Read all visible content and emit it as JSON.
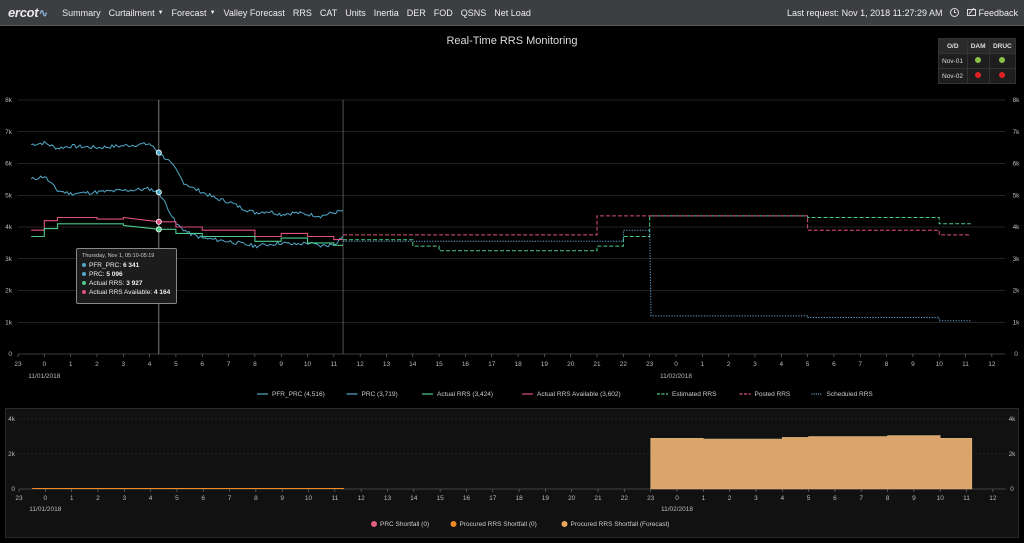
{
  "nav": {
    "logo": "ercot",
    "items": [
      {
        "label": "Summary"
      },
      {
        "label": "Curtailment",
        "dropdown": true
      },
      {
        "label": "Forecast",
        "dropdown": true
      },
      {
        "label": "Valley Forecast"
      },
      {
        "label": "RRS"
      },
      {
        "label": "CAT"
      },
      {
        "label": "Units"
      },
      {
        "label": "Inertia"
      },
      {
        "label": "DER"
      },
      {
        "label": "FOD"
      },
      {
        "label": "QSNS"
      },
      {
        "label": "Net Load"
      }
    ],
    "last_request": "Last request: Nov 1, 2018 11:27:29 AM",
    "feedback": "Feedback"
  },
  "od_table": {
    "headers": [
      "O/D",
      "DAM",
      "DRUC"
    ],
    "rows": [
      {
        "label": "Nov-01",
        "dam": "#8bc34a",
        "druc": "#8bc34a"
      },
      {
        "label": "Nov-02",
        "dam": "#e02020",
        "druc": "#e02020"
      }
    ]
  },
  "tooltip": {
    "header": "Thursday, Nov 1, 05:10-05:19",
    "rows": [
      {
        "label": "PFR_PRC: ",
        "value": "6 341",
        "color": "#4fa8c8"
      },
      {
        "label": "PRC: ",
        "value": "5 096",
        "color": "#4fa8c8"
      },
      {
        "label": "Actual RRS: ",
        "value": "3 927",
        "color": "#4ecb8a"
      },
      {
        "label": "Actual RRS Available: ",
        "value": "4 164",
        "color": "#e0507a"
      }
    ]
  },
  "chart_data": [
    {
      "type": "line",
      "title": "Real-Time RRS Monitoring",
      "x_ticks": [
        "23",
        "0",
        "1",
        "2",
        "3",
        "4",
        "5",
        "6",
        "7",
        "8",
        "9",
        "10",
        "11",
        "12",
        "13",
        "14",
        "15",
        "16",
        "17",
        "18",
        "19",
        "20",
        "21",
        "22",
        "23",
        "0",
        "1",
        "2",
        "3",
        "4",
        "5",
        "6",
        "7",
        "8",
        "9",
        "10",
        "11",
        "12"
      ],
      "date_labels": [
        {
          "tick": 1,
          "label": "11/01/2018"
        },
        {
          "tick": 25,
          "label": "11/02/2018"
        }
      ],
      "y_ticks": [
        "0",
        "1k",
        "2k",
        "3k",
        "4k",
        "5k",
        "6k",
        "7k",
        "8k"
      ],
      "ylim": [
        0,
        8000
      ],
      "xlim": [
        -1,
        36.5
      ],
      "crosshair_x": 4.35,
      "now_x": 11.35,
      "legend": [
        {
          "name": "PFR_PRC (4,516)",
          "color": "#4fa8c8",
          "dash": "solid"
        },
        {
          "name": "PRC (3,719)",
          "color": "#4fa8c8",
          "dash": "solid"
        },
        {
          "name": "Actual RRS (3,424)",
          "color": "#4ecb8a",
          "dash": "solid"
        },
        {
          "name": "Actual RRS Available (3,602)",
          "color": "#e0507a",
          "dash": "solid"
        },
        {
          "name": "Estimated RRS",
          "color": "#4ecb8a",
          "dash": "dash"
        },
        {
          "name": "Posted RRS",
          "color": "#e0507a",
          "dash": "dash"
        },
        {
          "name": "Scheduled RRS",
          "color": "#6aa8d8",
          "dash": "dot"
        }
      ],
      "series": {
        "pfr_prc": {
          "color": "#4fa8c8",
          "points": [
            [
              -0.5,
              6600
            ],
            [
              0,
              6650
            ],
            [
              0.5,
              6480
            ],
            [
              1,
              6550
            ],
            [
              2,
              6500
            ],
            [
              3,
              6560
            ],
            [
              4,
              6620
            ],
            [
              4.35,
              6341
            ],
            [
              4.7,
              6100
            ],
            [
              5,
              5800
            ],
            [
              5.3,
              5400
            ],
            [
              5.7,
              5200
            ],
            [
              6,
              5100
            ],
            [
              6.5,
              4900
            ],
            [
              7,
              4800
            ],
            [
              7.5,
              4600
            ],
            [
              8,
              4450
            ],
            [
              8.5,
              4500
            ],
            [
              9,
              4400
            ],
            [
              9.5,
              4450
            ],
            [
              10,
              4400
            ],
            [
              10.5,
              4350
            ],
            [
              11,
              4450
            ],
            [
              11.35,
              4516
            ]
          ]
        },
        "prc": {
          "color": "#4fa8c8",
          "points": [
            [
              -0.5,
              5500
            ],
            [
              0,
              5600
            ],
            [
              0.5,
              5150
            ],
            [
              1,
              5050
            ],
            [
              2,
              5100
            ],
            [
              3,
              5150
            ],
            [
              4,
              5200
            ],
            [
              4.35,
              5096
            ],
            [
              4.7,
              4600
            ],
            [
              5,
              4100
            ],
            [
              5.5,
              3800
            ],
            [
              6,
              3650
            ],
            [
              7,
              3550
            ],
            [
              8,
              3400
            ],
            [
              8.5,
              3450
            ],
            [
              9,
              3500
            ],
            [
              9.5,
              3450
            ],
            [
              10,
              3500
            ],
            [
              10.5,
              3400
            ],
            [
              11,
              3450
            ],
            [
              11.35,
              3719
            ]
          ]
        },
        "actual_rrs": {
          "color": "#4ecb8a",
          "points": [
            [
              -0.5,
              3700
            ],
            [
              0,
              3700
            ],
            [
              0,
              3950
            ],
            [
              0.5,
              3950
            ],
            [
              0.5,
              4100
            ],
            [
              3,
              4100
            ],
            [
              3,
              4050
            ],
            [
              4.35,
              3927
            ],
            [
              5,
              3927
            ],
            [
              5,
              3800
            ],
            [
              6,
              3800
            ],
            [
              6,
              3700
            ],
            [
              8,
              3700
            ],
            [
              8,
              3550
            ],
            [
              9,
              3550
            ],
            [
              9,
              3650
            ],
            [
              10,
              3650
            ],
            [
              10,
              3500
            ],
            [
              11,
              3500
            ],
            [
              11,
              3424
            ],
            [
              11.35,
              3424
            ]
          ]
        },
        "actual_rrs_available": {
          "color": "#e0507a",
          "points": [
            [
              -0.5,
              3900
            ],
            [
              0,
              3900
            ],
            [
              0,
              4200
            ],
            [
              0.5,
              4200
            ],
            [
              0.5,
              4300
            ],
            [
              2,
              4300
            ],
            [
              2,
              4250
            ],
            [
              3,
              4250
            ],
            [
              3,
              4300
            ],
            [
              4.35,
              4164
            ],
            [
              5,
              4164
            ],
            [
              5,
              4000
            ],
            [
              6,
              4000
            ],
            [
              6,
              3900
            ],
            [
              8,
              3900
            ],
            [
              8,
              3700
            ],
            [
              9,
              3700
            ],
            [
              9,
              3800
            ],
            [
              10,
              3800
            ],
            [
              10,
              3700
            ],
            [
              11,
              3700
            ],
            [
              11,
              3602
            ],
            [
              11.35,
              3602
            ]
          ]
        },
        "estimated_rrs": {
          "color": "#4ecb8a",
          "dash": "4,2",
          "points": [
            [
              11.35,
              3600
            ],
            [
              14,
              3600
            ],
            [
              14,
              3400
            ],
            [
              15,
              3400
            ],
            [
              15,
              3250
            ],
            [
              21,
              3250
            ],
            [
              21,
              3400
            ],
            [
              22,
              3400
            ],
            [
              22,
              3700
            ],
            [
              23,
              3700
            ],
            [
              23,
              4350
            ],
            [
              29,
              4350
            ],
            [
              29,
              4300
            ],
            [
              34,
              4300
            ],
            [
              34,
              4100
            ],
            [
              35.2,
              4100
            ]
          ]
        },
        "posted_rrs": {
          "color": "#e0507a",
          "dash": "4,2",
          "points": [
            [
              11.35,
              3750
            ],
            [
              21,
              3750
            ],
            [
              21,
              4350
            ],
            [
              29,
              4350
            ],
            [
              29,
              3900
            ],
            [
              34,
              3900
            ],
            [
              34,
              3750
            ],
            [
              35.2,
              3750
            ]
          ]
        },
        "scheduled_rrs": {
          "color": "#6aa8d8",
          "dash": "1.2,1.5",
          "points": [
            [
              11.35,
              3550
            ],
            [
              22,
              3550
            ],
            [
              22,
              3900
            ],
            [
              23,
              3900
            ],
            [
              23.05,
              1200
            ],
            [
              29,
              1200
            ],
            [
              29,
              1150
            ],
            [
              34,
              1150
            ],
            [
              34,
              1050
            ],
            [
              35.2,
              1050
            ]
          ]
        }
      }
    },
    {
      "type": "area",
      "x_ticks": [
        "23",
        "0",
        "1",
        "2",
        "3",
        "4",
        "5",
        "6",
        "7",
        "8",
        "9",
        "10",
        "11",
        "12",
        "13",
        "14",
        "15",
        "16",
        "17",
        "18",
        "19",
        "20",
        "21",
        "22",
        "23",
        "0",
        "1",
        "2",
        "3",
        "4",
        "5",
        "6",
        "7",
        "8",
        "9",
        "10",
        "11",
        "12"
      ],
      "date_labels": [
        {
          "tick": 1,
          "label": "11/01/2018"
        },
        {
          "tick": 25,
          "label": "11/02/2018"
        }
      ],
      "y_ticks": [
        "0",
        "2k",
        "4k"
      ],
      "ylim": [
        0,
        4000
      ],
      "xlim": [
        -1,
        36.5
      ],
      "legend": [
        {
          "name": "PRC Shortfall (0)",
          "color": "#e06080"
        },
        {
          "name": "Procured RRS Shortfall (0)",
          "color": "#f08a28"
        },
        {
          "name": "Procured RRS Shortfall (Forecast)",
          "color": "#f0a860"
        }
      ],
      "series": {
        "procured_shortfall": {
          "color": "#f08a28",
          "points": [
            [
              -0.5,
              0
            ],
            [
              11.35,
              0
            ]
          ]
        },
        "forecast_shortfall": {
          "color": "#d9a56c",
          "points": [
            [
              23,
              2900
            ],
            [
              24,
              2900
            ],
            [
              25,
              2850
            ],
            [
              26,
              2850
            ],
            [
              27,
              2850
            ],
            [
              28,
              2950
            ],
            [
              29,
              3000
            ],
            [
              30,
              3000
            ],
            [
              31,
              3000
            ],
            [
              32,
              3050
            ],
            [
              33,
              3050
            ],
            [
              34,
              2900
            ],
            [
              35.2,
              2900
            ]
          ]
        }
      }
    }
  ]
}
